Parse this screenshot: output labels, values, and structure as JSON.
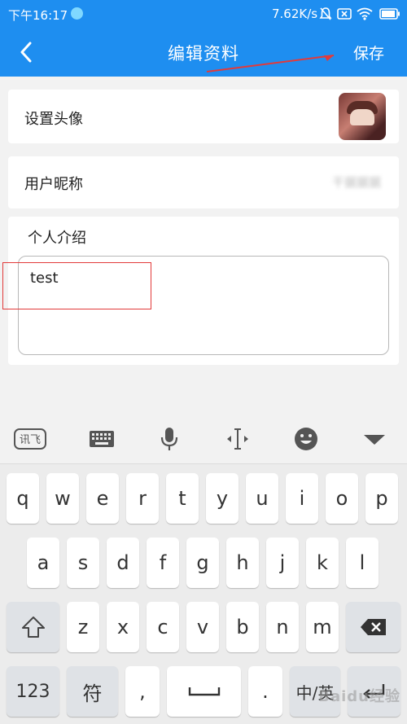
{
  "status_bar": {
    "time": "下午16:17",
    "speed": "7.62K/s"
  },
  "header": {
    "back_icon": "back-arrow-icon",
    "title": "编辑资料",
    "save_label": "保存"
  },
  "form": {
    "avatar_label": "设置头像",
    "nickname_label": "用户昵称",
    "nickname_value": "干据据据",
    "intro_label": "个人介绍",
    "intro_value": "test"
  },
  "keyboard": {
    "toolbar": [
      "xunfei-logo-icon",
      "keyboard-icon",
      "microphone-icon",
      "cursor-icon",
      "emoji-icon",
      "collapse-icon"
    ],
    "toolbar_logo_text": "讯飞",
    "row1": [
      "q",
      "w",
      "e",
      "r",
      "t",
      "y",
      "u",
      "i",
      "o",
      "p"
    ],
    "row2": [
      "a",
      "s",
      "d",
      "f",
      "g",
      "h",
      "j",
      "k",
      "l"
    ],
    "row3": [
      "z",
      "x",
      "c",
      "v",
      "b",
      "n",
      "m"
    ],
    "numbers_label": "123",
    "symbols_label": "符",
    "comma_label": ",",
    "period_label": ".",
    "lang_label": "中/英",
    "watermark": "Baidu经验"
  },
  "colors": {
    "primary": "#1e8ef0",
    "annotation": "#e23a3a"
  }
}
